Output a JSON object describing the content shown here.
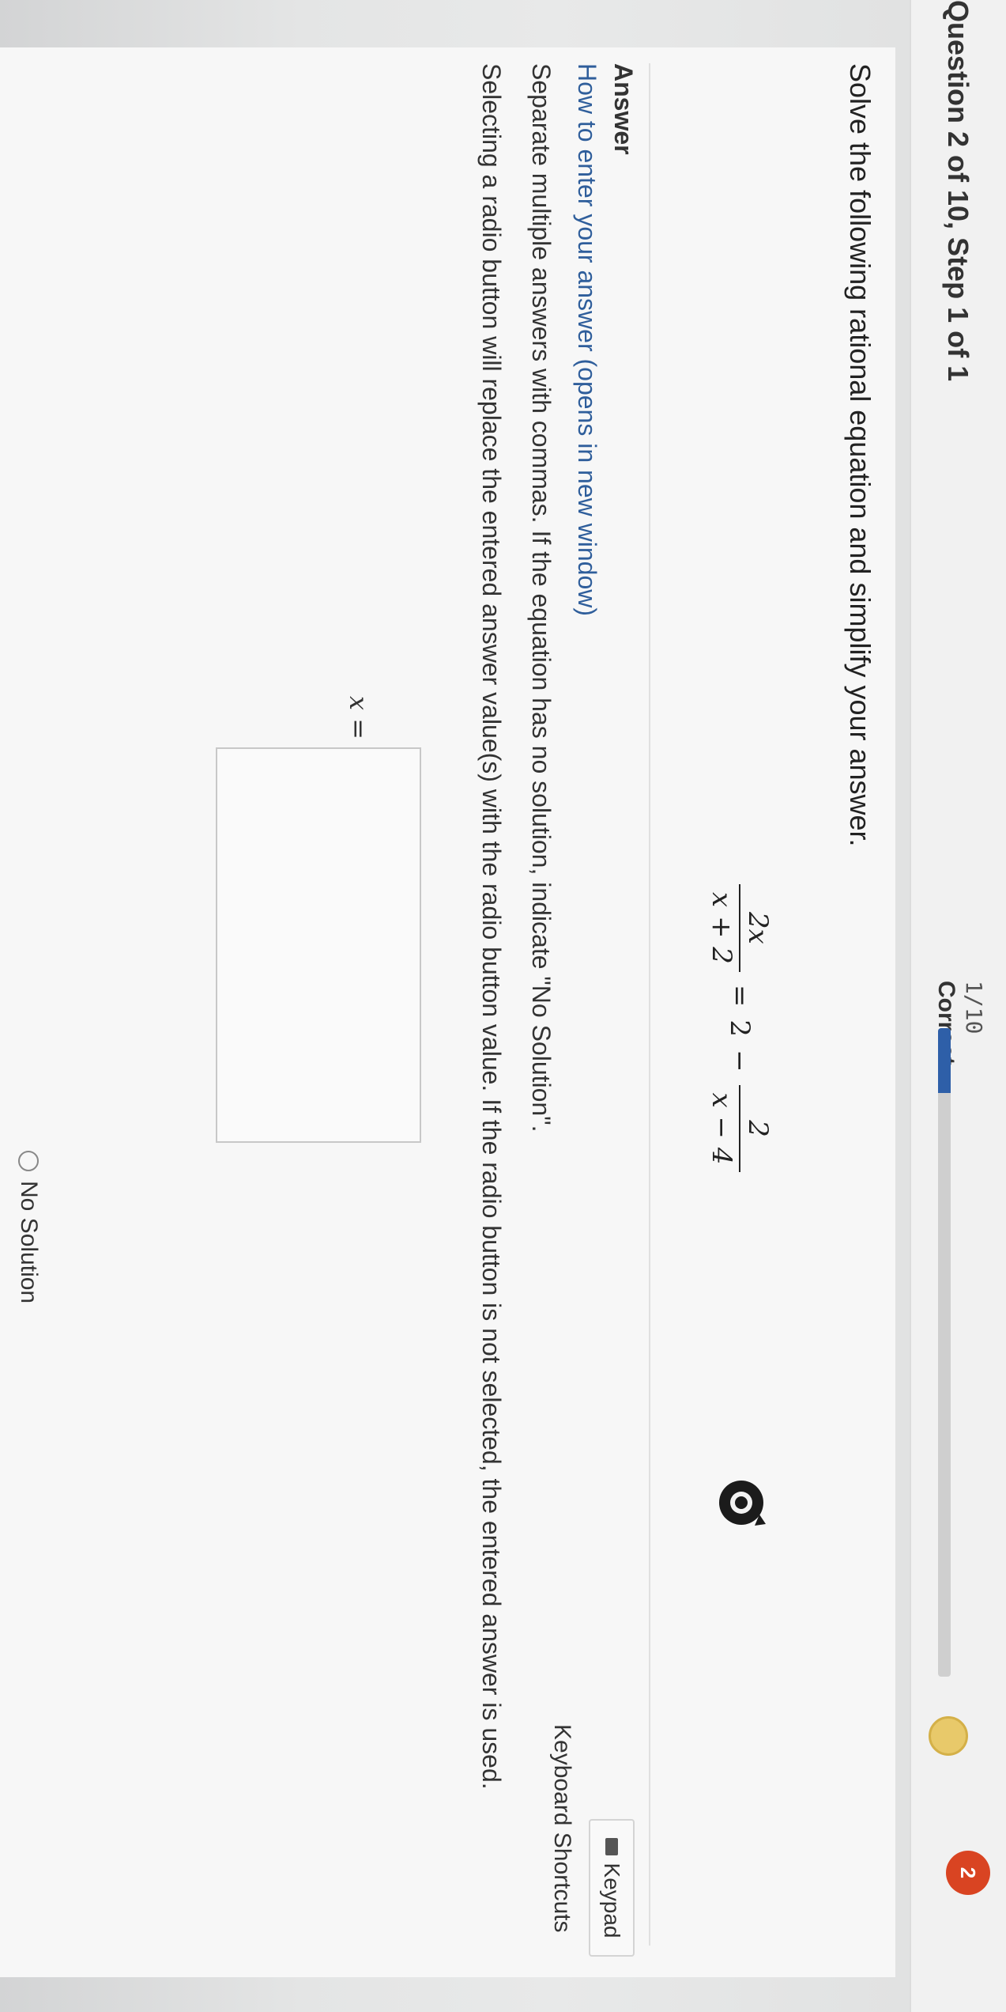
{
  "header": {
    "question_label": "Question 2 of 10, Step 1 of 1",
    "score_fraction": "1/10",
    "score_status": "Correct",
    "progress": 0.1,
    "badge_count": "2"
  },
  "question": {
    "prompt": "Solve the following rational equation and simplify your answer.",
    "equation": {
      "lhs_num": "2x",
      "lhs_den": "x + 2",
      "equals": "=",
      "constant": "2",
      "minus": "−",
      "rhs_num": "2",
      "rhs_den": "x − 4"
    }
  },
  "answer": {
    "heading": "Answer",
    "how_to_link": "How to enter your answer (opens in new window)",
    "keypad_label": "Keypad",
    "shortcuts_label": "Keyboard Shortcuts",
    "instructions_1": "Separate multiple answers with commas. If the equation has no solution, indicate \"No Solution\".",
    "instructions_2": "Selecting a radio button will replace the entered answer value(s) with the radio button value. If the radio button is not selected, the entered answer is used.",
    "x_label": "x =",
    "input_value": "",
    "no_solution_label": "No Solution"
  },
  "colors": {
    "link": "#2f5e9b",
    "progress_fill": "#2e5fa8",
    "badge": "#d94422",
    "green_strip": "#5a8a4a"
  }
}
